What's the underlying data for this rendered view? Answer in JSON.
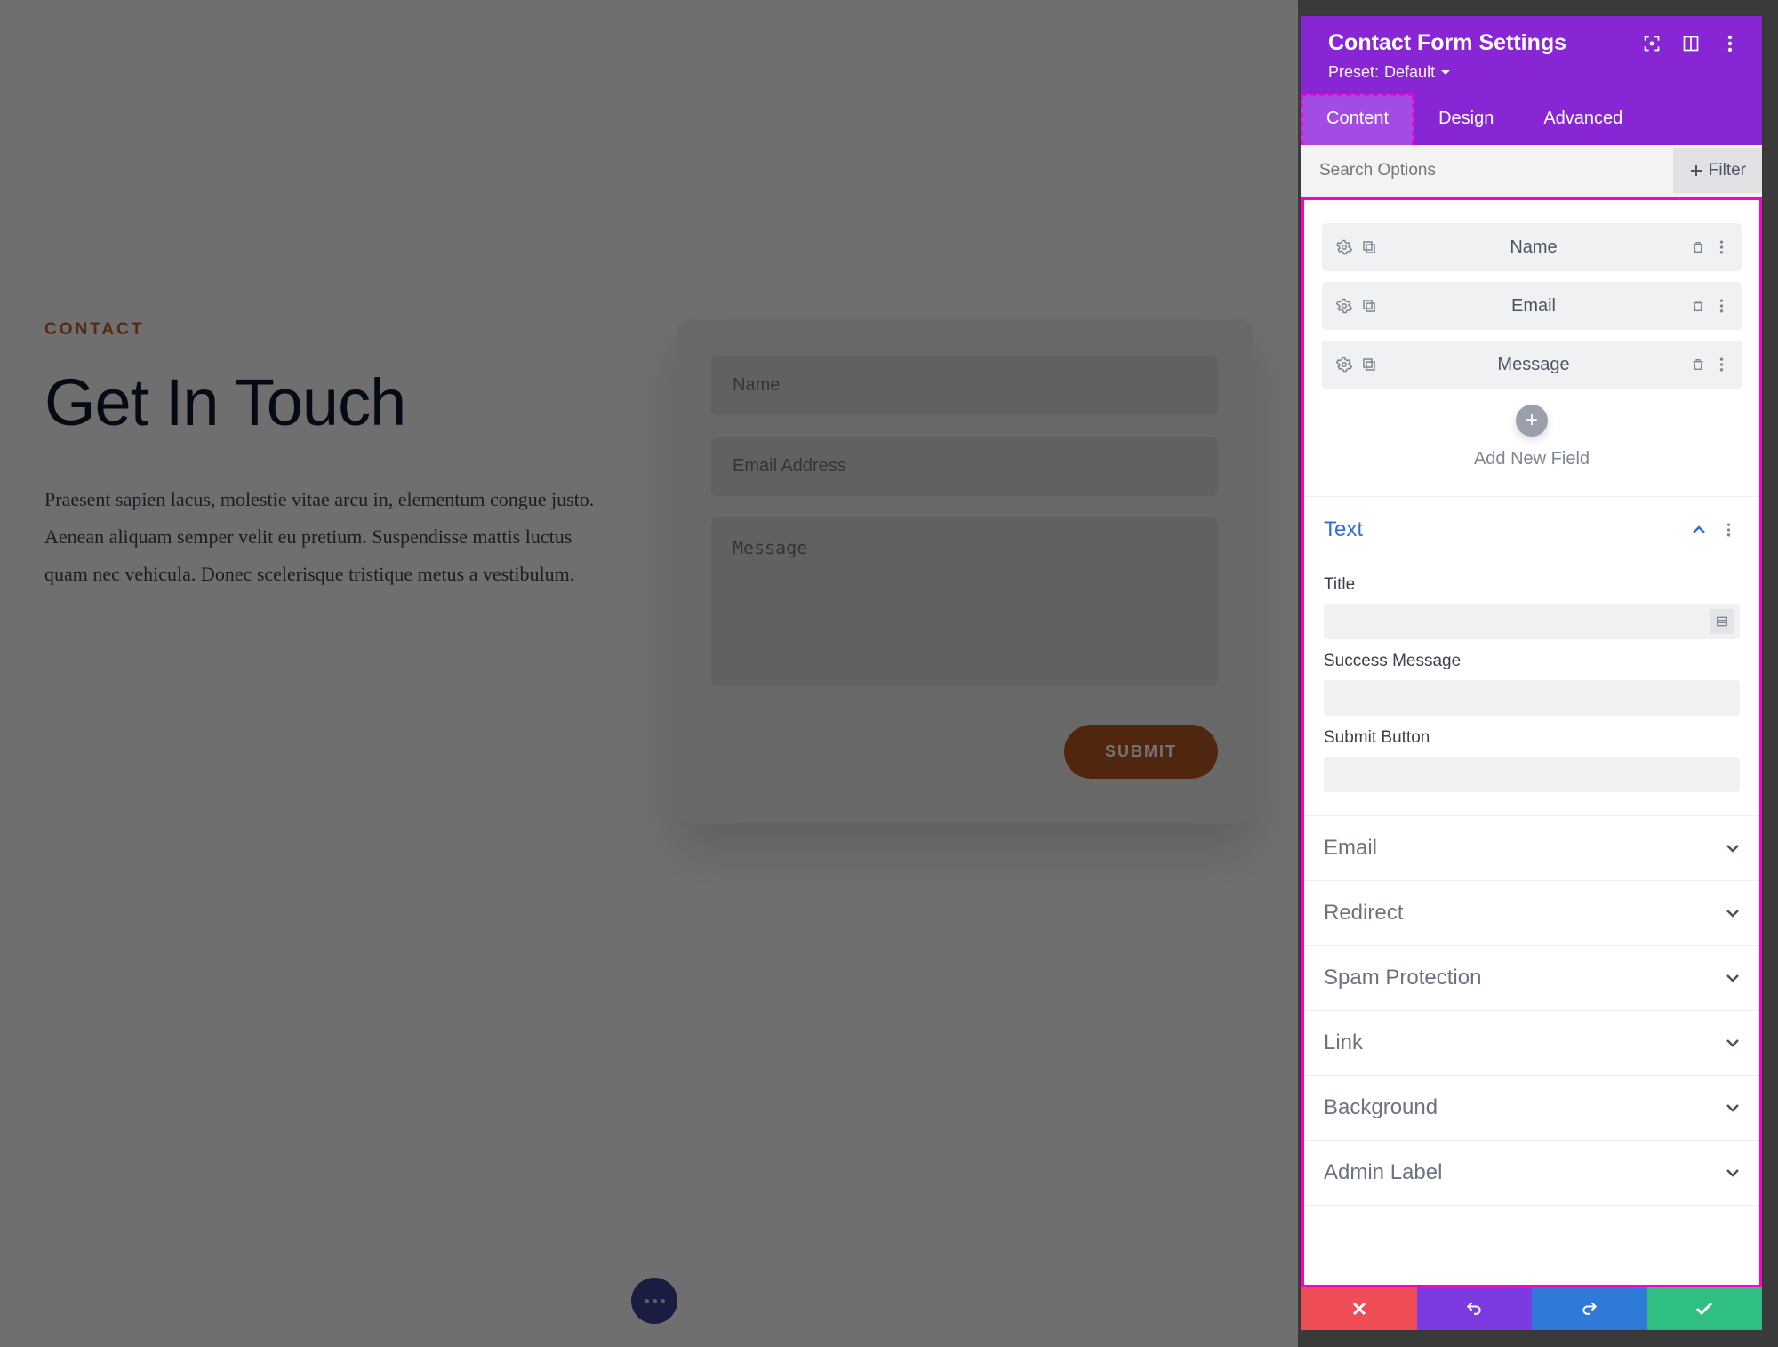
{
  "preview": {
    "eyebrow": "CONTACT",
    "heading": "Get In Touch",
    "body": "Praesent sapien lacus, molestie vitae arcu in, elementum congue justo. Aenean aliquam semper velit eu pretium. Suspendisse mattis luctus quam nec vehicula. Donec scelerisque tristique metus a vestibulum.",
    "name_ph": "Name",
    "email_ph": "Email Address",
    "msg_ph": "Message",
    "submit": "SUBMIT"
  },
  "panel": {
    "title": "Contact Form Settings",
    "preset_label": "Preset:",
    "preset_value": "Default",
    "tabs": {
      "content": "Content",
      "design": "Design",
      "advanced": "Advanced"
    },
    "search_ph": "Search Options",
    "filter": "Filter",
    "fields": [
      "Name",
      "Email",
      "Message"
    ],
    "add_new": "Add New Field",
    "sections": {
      "text": "Text",
      "title_label": "Title",
      "success_label": "Success Message",
      "submit_label": "Submit Button",
      "email": "Email",
      "redirect": "Redirect",
      "spam": "Spam Protection",
      "link": "Link",
      "background": "Background",
      "admin": "Admin Label"
    },
    "values": {
      "title": "",
      "success": "",
      "submit_btn": ""
    }
  }
}
